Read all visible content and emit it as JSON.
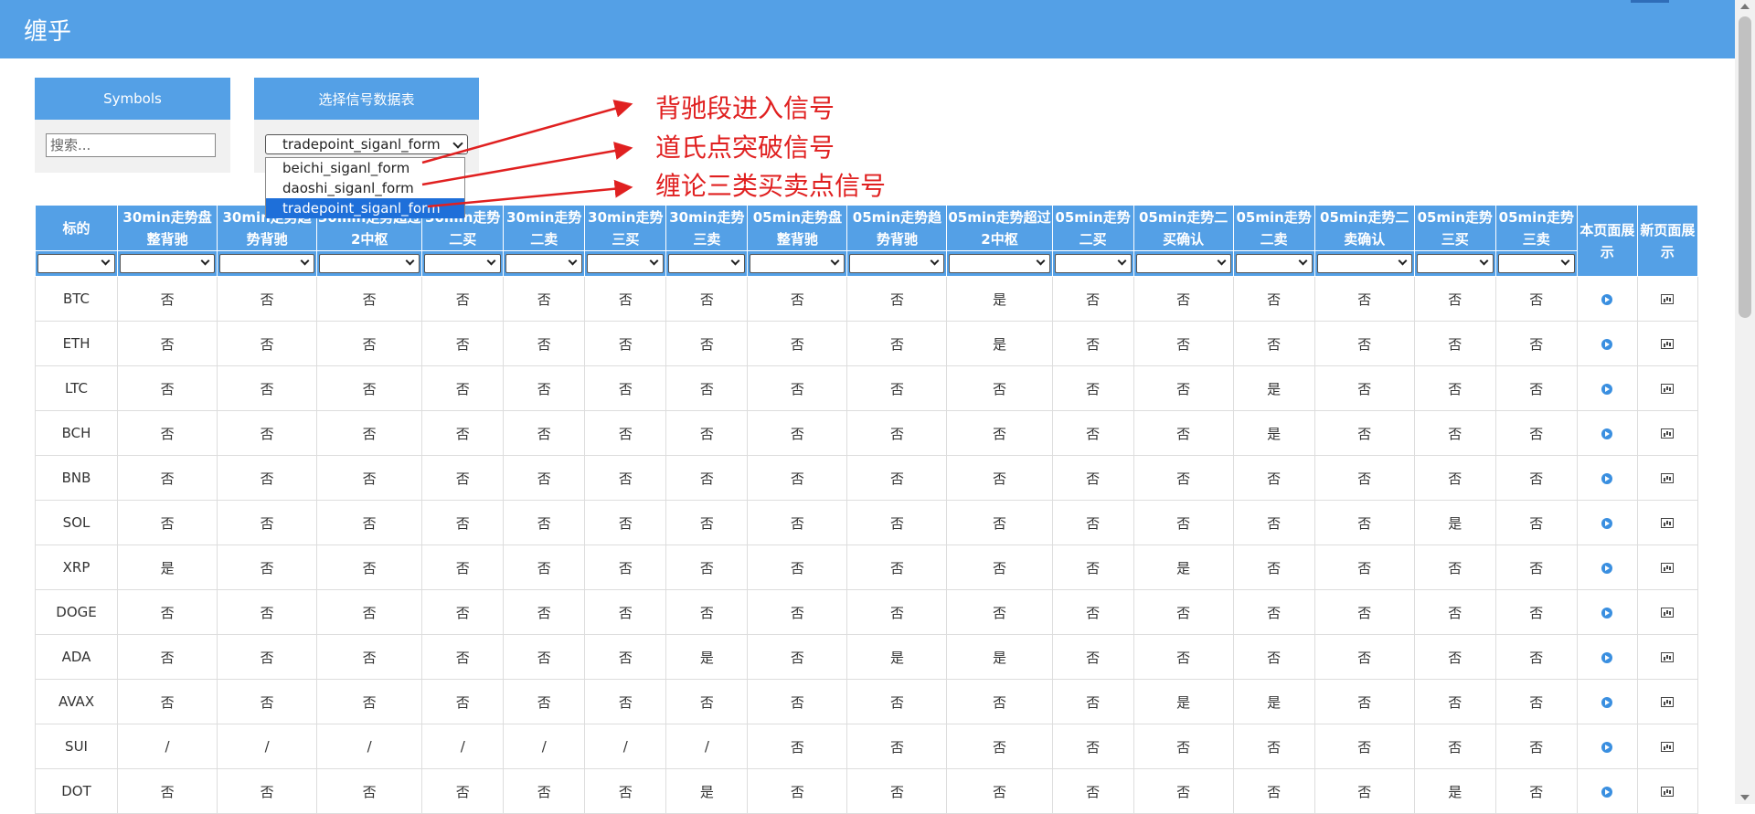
{
  "app": {
    "title": "缠乎"
  },
  "symbols_panel": {
    "header": "Symbols",
    "search_placeholder": "搜索..."
  },
  "signal_panel": {
    "header": "选择信号数据表",
    "selected": "tradepoint_siganl_form",
    "options": [
      "beichi_siganl_form",
      "daoshi_siganl_form",
      "tradepoint_siganl_form"
    ]
  },
  "annotations": [
    "背驰段进入信号",
    "道氏点突破信号",
    "缠论三类买卖点信号"
  ],
  "colors": {
    "primary": "#54a0e6",
    "annotation": "#e02020",
    "selected_option": "#1e6fd9"
  },
  "table": {
    "headers": [
      "标的",
      "30min走势盘整背驰",
      "30min走势趋势背驰",
      "30min走势超过2中枢",
      "30min走势二买",
      "30min走势二卖",
      "30min走势三买",
      "30min走势三卖",
      "05min走势盘整背驰",
      "05min走势趋势背驰",
      "05min走势超过2中枢",
      "05min走势二买",
      "05min走势二买确认",
      "05min走势二卖",
      "05min走势二卖确认",
      "05min走势三买",
      "05min走势三卖",
      "本页面展示",
      "新页面展示"
    ],
    "rows": [
      {
        "symbol": "BTC",
        "values": [
          "否",
          "否",
          "否",
          "否",
          "否",
          "否",
          "否",
          "否",
          "否",
          "是",
          "否",
          "否",
          "否",
          "否",
          "否",
          "否"
        ]
      },
      {
        "symbol": "ETH",
        "values": [
          "否",
          "否",
          "否",
          "否",
          "否",
          "否",
          "否",
          "否",
          "否",
          "是",
          "否",
          "否",
          "否",
          "否",
          "否",
          "否"
        ]
      },
      {
        "symbol": "LTC",
        "values": [
          "否",
          "否",
          "否",
          "否",
          "否",
          "否",
          "否",
          "否",
          "否",
          "否",
          "否",
          "否",
          "是",
          "否",
          "否",
          "否"
        ]
      },
      {
        "symbol": "BCH",
        "values": [
          "否",
          "否",
          "否",
          "否",
          "否",
          "否",
          "否",
          "否",
          "否",
          "否",
          "否",
          "否",
          "是",
          "否",
          "否",
          "否"
        ]
      },
      {
        "symbol": "BNB",
        "values": [
          "否",
          "否",
          "否",
          "否",
          "否",
          "否",
          "否",
          "否",
          "否",
          "否",
          "否",
          "否",
          "否",
          "否",
          "否",
          "否"
        ]
      },
      {
        "symbol": "SOL",
        "values": [
          "否",
          "否",
          "否",
          "否",
          "否",
          "否",
          "否",
          "否",
          "否",
          "否",
          "否",
          "否",
          "否",
          "否",
          "是",
          "否"
        ]
      },
      {
        "symbol": "XRP",
        "values": [
          "是",
          "否",
          "否",
          "否",
          "否",
          "否",
          "否",
          "否",
          "否",
          "否",
          "否",
          "是",
          "否",
          "否",
          "否",
          "否"
        ]
      },
      {
        "symbol": "DOGE",
        "values": [
          "否",
          "否",
          "否",
          "否",
          "否",
          "否",
          "否",
          "否",
          "否",
          "否",
          "否",
          "否",
          "否",
          "否",
          "否",
          "否"
        ]
      },
      {
        "symbol": "ADA",
        "values": [
          "否",
          "否",
          "否",
          "否",
          "否",
          "否",
          "是",
          "否",
          "是",
          "是",
          "否",
          "否",
          "否",
          "否",
          "否",
          "否"
        ]
      },
      {
        "symbol": "AVAX",
        "values": [
          "否",
          "否",
          "否",
          "否",
          "否",
          "否",
          "否",
          "否",
          "否",
          "否",
          "否",
          "是",
          "是",
          "否",
          "否",
          "否"
        ]
      },
      {
        "symbol": "SUI",
        "values": [
          "/",
          "/",
          "/",
          "/",
          "/",
          "/",
          "/",
          "否",
          "否",
          "否",
          "否",
          "否",
          "否",
          "否",
          "否",
          "否"
        ]
      },
      {
        "symbol": "DOT",
        "values": [
          "否",
          "否",
          "否",
          "否",
          "否",
          "否",
          "是",
          "否",
          "否",
          "否",
          "否",
          "否",
          "否",
          "否",
          "是",
          "否"
        ]
      }
    ]
  }
}
